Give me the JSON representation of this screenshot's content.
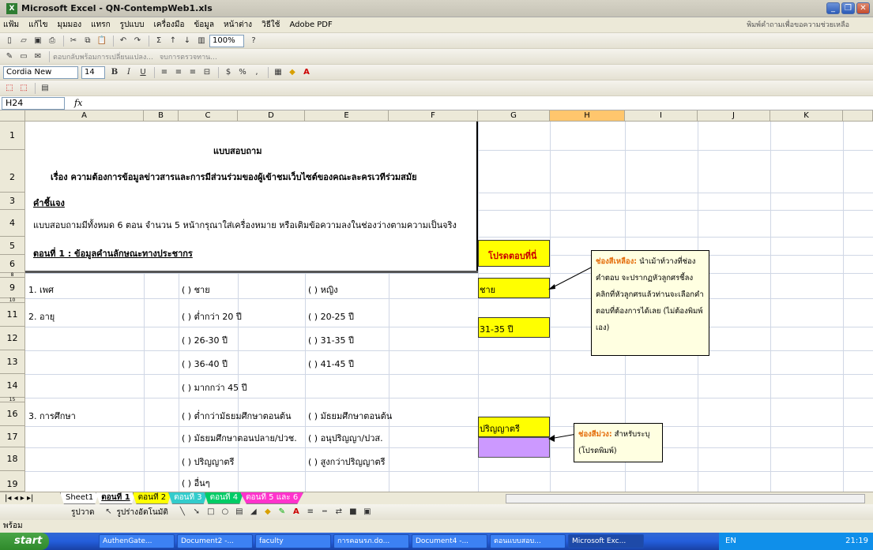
{
  "window": {
    "title": "Microsoft Excel - QN-ContempWeb1.xls",
    "help_placeholder": "พิมพ์คำถามเพื่อขอความช่วยเหลือ"
  },
  "menu": [
    "แฟ้ม",
    "แก้ไข",
    "มุมมอง",
    "แทรก",
    "รูปแบบ",
    "เครื่องมือ",
    "ข้อมูล",
    "หน้าต่าง",
    "วิธีใช้",
    "Adobe PDF"
  ],
  "toolbar": {
    "font_name": "Cordia New",
    "font_size": "14",
    "zoom": "100%",
    "reply_text": "ตอบกลับพร้อมการเปลี่ยนแปลง...",
    "end_review": "จบการตรวจทาน..."
  },
  "formula": {
    "namebox": "H24",
    "fx": "fx"
  },
  "columns": [
    "A",
    "B",
    "C",
    "D",
    "E",
    "F",
    "G",
    "H",
    "I",
    "J",
    "K"
  ],
  "rows": [
    "1",
    "2",
    "3",
    "4",
    "5",
    "6",
    "8",
    "9",
    "10",
    "11",
    "12",
    "13",
    "14",
    "15",
    "16",
    "17",
    "18",
    "19"
  ],
  "content": {
    "r1": "แบบสอบถาม",
    "r2": "เรื่อง ความต้องการข้อมูลข่าวสารและการมีส่วนร่วมของผู้เข้าชมเว็บไซต์ของคณะละครเวทีร่วมสมัย",
    "r3": "คำชี้แจง",
    "r4": "แบบสอบถามมีทั้งหมด 6 ตอน จำนวน 5 หน้ากรุณาใส่เครื่องหมาย  หรือเติมข้อความลงในช่องว่างตามความเป็นจริง",
    "r6": "ตอนที่ 1 : ข้อมูลคำนลักษณะทางประชากร",
    "g6": "โปรดตอบที่นี่",
    "r9a": "1. เพศ",
    "r9c": "(  ) ชาย",
    "r9e": "(  ) หญิง",
    "r9g": "ชาย",
    "r11a": "2. อายุ",
    "r11c": "(  ) ต่ำกว่า 20 ปี",
    "r11e": "(  ) 20-25 ปี",
    "r11g": "31-35 ปี",
    "r12c": "(  ) 26-30 ปี",
    "r12e": "(  ) 31-35 ปี",
    "r13c": "(  ) 36-40 ปี",
    "r13e": "(  ) 41-45 ปี",
    "r14c": "(  ) มากกว่า 45 ปี",
    "r16a": "3. การศึกษา",
    "r16c": "(  ) ต่ำกว่ามัธยมศึกษาตอนต้น",
    "r16e": "(  ) มัธยมศึกษาตอนต้น",
    "r16g": "ปริญญาตรี",
    "r17c": "(  ) มัธยมศึกษาตอนปลาย/ปวช.",
    "r17e": "(  ) อนุปริญญา/ปวส.",
    "r18c": "(  ) ปริญญาตรี",
    "r18e": "(  ) สูงกว่าปริญญาตรี",
    "r19c": "(  ) อื่นๆ"
  },
  "comments": {
    "yellow_title": "ช่องสีเหลือง:",
    "yellow_body": "นำเม้าท์วางที่ช่องคำตอบ จะปรากฏหัวลูกศรชี้ลงคลิกที่หัวลูกศรแล้วท่านจะเลือกคำตอบที่ต้องการได้เลย (ไม่ต้องพิมพ์เอง)",
    "purple_title": "ช่องสีม่วง:",
    "purple_body": "สำหรับระบุ (โปรดพิมพ์)"
  },
  "sheets": [
    "Sheet1",
    "ตอนที่ 1",
    "ตอนที่ 2",
    "ตอนที่ 3",
    "ตอนที่ 4",
    "ตอนที่ 5 และ 6"
  ],
  "drawbar": {
    "draw": "รูปวาด",
    "autoshapes": "รูปร่างอัตโนมัติ"
  },
  "status": "พร้อม",
  "taskbar": {
    "start": "start",
    "tasks": [
      "AuthenGate...",
      "Document2 -...",
      "faculty",
      "การคอนรภ.do...",
      "Document4 -...",
      "ตอนแบบสอบ...",
      "Microsoft Exc..."
    ],
    "tray_lang": "EN",
    "clock": "21:19"
  },
  "colors": {
    "yellow": "#ffff00",
    "lavender": "#cc99ff",
    "selected_header": "#ffc66d"
  }
}
